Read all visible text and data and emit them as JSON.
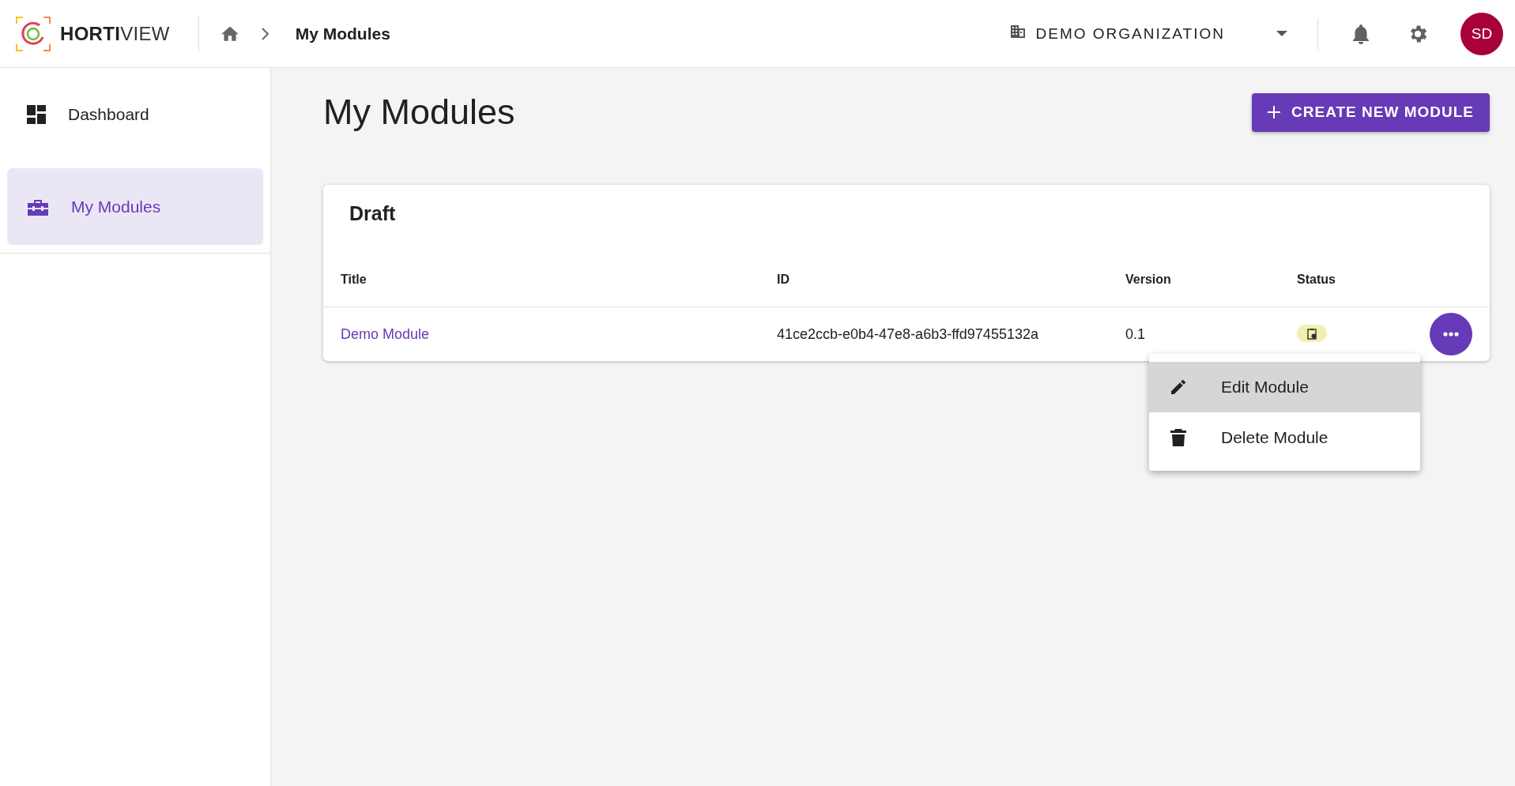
{
  "header": {
    "brand_bold": "HORTI",
    "brand_light": "VIEW",
    "breadcrumb": "My Modules",
    "organization": "DEMO ORGANIZATION",
    "avatar": "SD"
  },
  "sidebar": {
    "items": [
      {
        "label": "Dashboard",
        "kind": "dashboard",
        "selected": false
      },
      {
        "label": "My Modules",
        "kind": "modules",
        "selected": true
      }
    ]
  },
  "page": {
    "title": "My Modules",
    "create_button": "CREATE NEW MODULE"
  },
  "table": {
    "title": "Draft",
    "columns": [
      "Title",
      "ID",
      "Version",
      "Status"
    ],
    "rows": [
      {
        "title": "Demo Module",
        "id": "41ce2ccb-e0b4-47e8-a6b3-ffd97455132a",
        "version": "0.1"
      }
    ]
  },
  "menu": {
    "items": [
      {
        "label": "Edit Module",
        "kind": "edit",
        "selected": true
      },
      {
        "label": "Delete Module",
        "kind": "delete",
        "selected": false
      }
    ]
  }
}
